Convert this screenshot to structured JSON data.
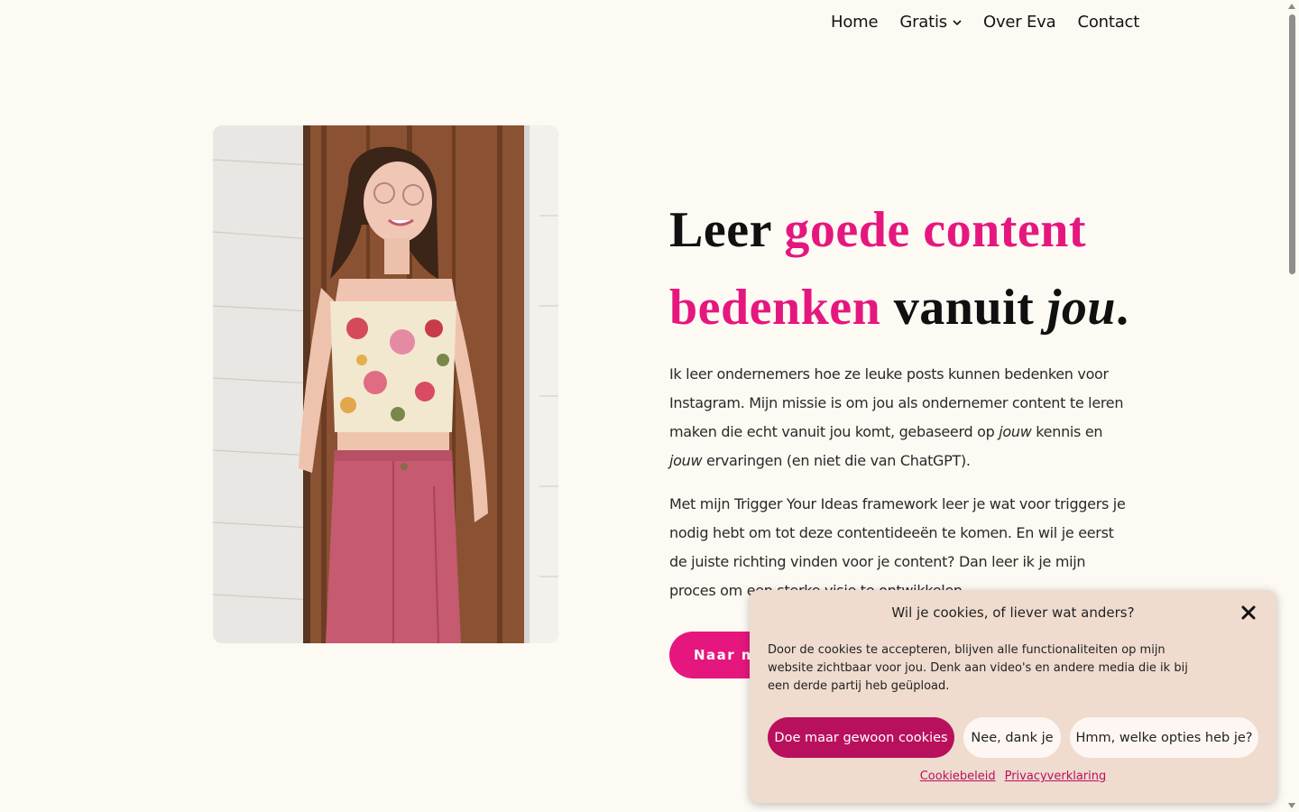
{
  "nav": {
    "items": [
      {
        "label": "Home"
      },
      {
        "label": "Gratis"
      },
      {
        "label": "Over Eva"
      },
      {
        "label": "Contact"
      }
    ]
  },
  "hero": {
    "headline": {
      "part1": "Leer ",
      "part2": "goede content",
      "part3": "bedenken",
      "part4": " vanuit ",
      "part5": "jou",
      "part6": "."
    },
    "para1": {
      "a": "Ik leer ondernemers hoe ze leuke posts kunnen bedenken voor Instagram. Mijn missie is om jou als ondernemer content te leren maken die echt vanuit jou komt, gebaseerd op ",
      "b": "jouw",
      "c": " kennis en ",
      "d": "jouw",
      "e": " ervaringen (en niet die van ChatGPT)."
    },
    "para2": "Met mijn Trigger Your Ideas framework leer je wat voor triggers je nodig hebt om tot deze contentideeën te komen. En wil je eerst de juiste richting vinden voor je content? Dan leer ik je mijn proces om een sterke visie te ontwikkelen.",
    "cta_label": "Naar mi"
  },
  "cookie": {
    "title": "Wil je cookies, of liever wat anders?",
    "text": "Door de cookies te accepteren, blijven alle functionaliteiten op mijn website zichtbaar voor jou. Denk aan video's en andere media die ik bij een derde partij heb geüpload.",
    "accept_label": "Doe maar gewoon cookies",
    "deny_label": "Nee, dank je",
    "options_label": "Hmm, welke opties heb je?",
    "link1": "Cookiebeleid",
    "link2": "Privacyverklaring"
  },
  "colors": {
    "accent": "#e5177e",
    "cookie_accent": "#b9105d",
    "background": "#fdf9f3",
    "cookie_bg": "#efdccf"
  }
}
